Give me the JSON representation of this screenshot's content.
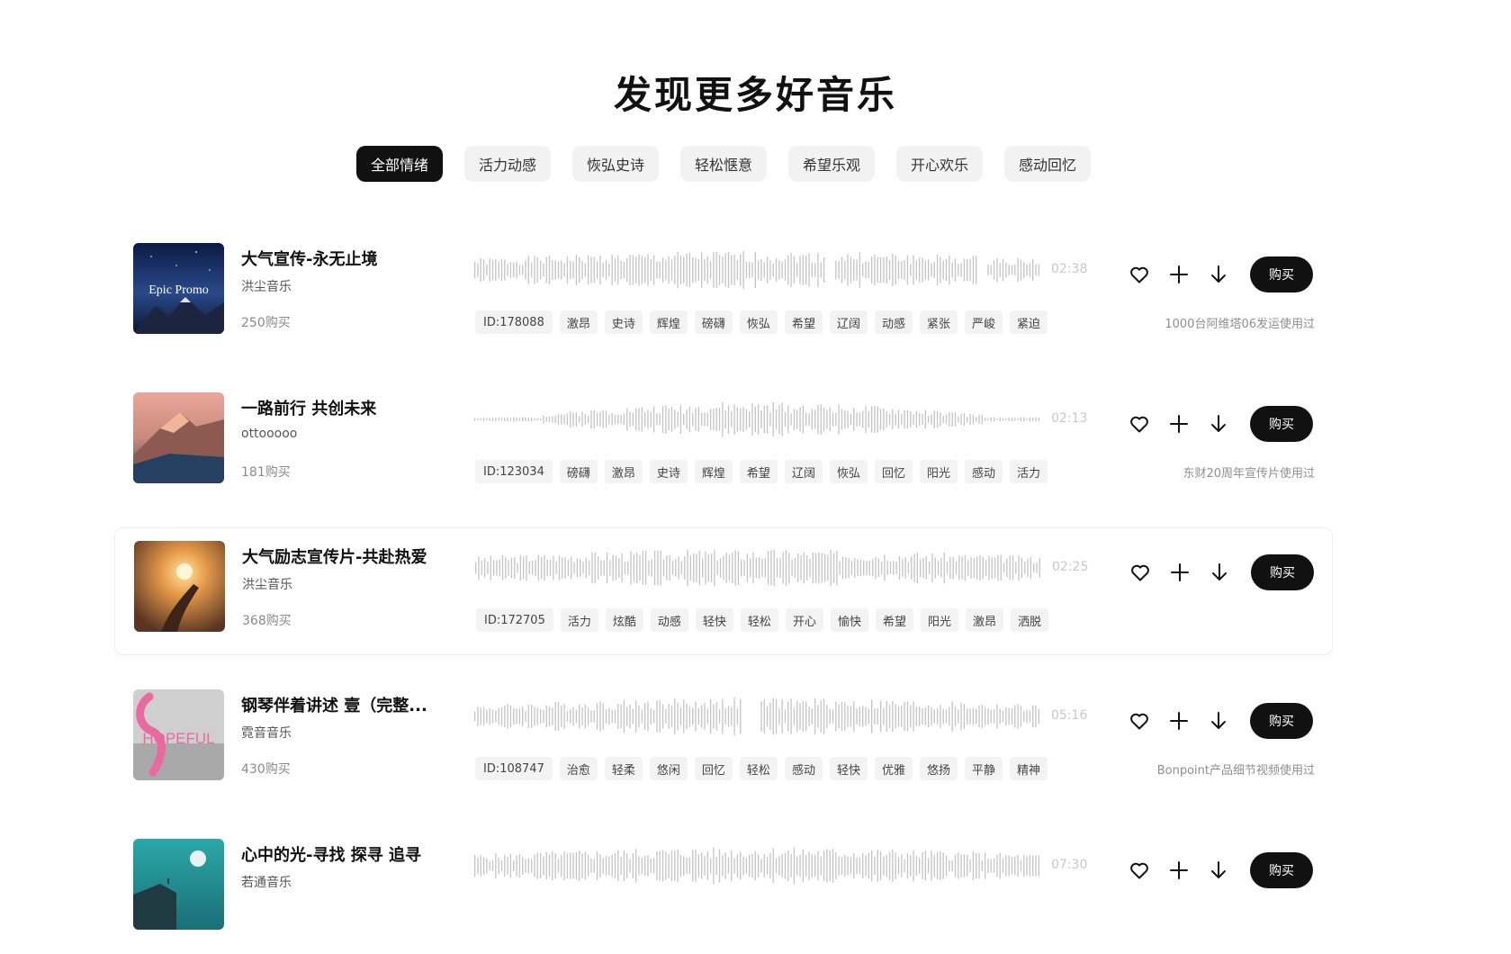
{
  "page": {
    "title": "发现更多好音乐"
  },
  "filters": [
    {
      "label": "全部情绪",
      "active": true
    },
    {
      "label": "活力动感",
      "active": false
    },
    {
      "label": "恢弘史诗",
      "active": false
    },
    {
      "label": "轻松惬意",
      "active": false
    },
    {
      "label": "希望乐观",
      "active": false
    },
    {
      "label": "开心欢乐",
      "active": false
    },
    {
      "label": "感动回忆",
      "active": false
    }
  ],
  "tracks": [
    {
      "title": "大气宣传-永无止境",
      "author": "洪尘音乐",
      "sales": "250购买",
      "duration": "02:38",
      "id_label": "ID:178088",
      "tags": [
        "激昂",
        "史诗",
        "辉煌",
        "磅礴",
        "恢弘",
        "希望",
        "辽阔",
        "动感",
        "紧张",
        "严峻",
        "紧迫"
      ],
      "usage": "1000台阿维塔06发运使用过",
      "buy_label": "购买",
      "cover_text": "Epic Promo"
    },
    {
      "title": "一路前行 共创未来",
      "author": "ottooooo",
      "sales": "181购买",
      "duration": "02:13",
      "id_label": "ID:123034",
      "tags": [
        "磅礴",
        "激昂",
        "史诗",
        "辉煌",
        "希望",
        "辽阔",
        "恢弘",
        "回忆",
        "阳光",
        "感动",
        "活力"
      ],
      "usage": "东财20周年宣传片使用过",
      "buy_label": "购买",
      "cover_text": ""
    },
    {
      "title": "大气励志宣传片-共赴热爱",
      "author": "洪尘音乐",
      "sales": "368购买",
      "duration": "02:25",
      "id_label": "ID:172705",
      "tags": [
        "活力",
        "炫酷",
        "动感",
        "轻快",
        "轻松",
        "开心",
        "愉快",
        "希望",
        "阳光",
        "激昂",
        "洒脱"
      ],
      "usage": "",
      "buy_label": "购买",
      "cover_text": ""
    },
    {
      "title": "钢琴伴着讲述 壹（完整...",
      "author": "霓音音乐",
      "sales": "430购买",
      "duration": "05:16",
      "id_label": "ID:108747",
      "tags": [
        "治愈",
        "轻柔",
        "悠闲",
        "回忆",
        "轻松",
        "感动",
        "轻快",
        "优雅",
        "悠扬",
        "平静",
        "精神"
      ],
      "usage": "Bonpoint产品细节视频使用过",
      "buy_label": "购买",
      "cover_text": "HOPEFUL"
    },
    {
      "title": "心中的光-寻找 探寻 追寻",
      "author": "若通音乐",
      "sales": "",
      "duration": "07:30",
      "id_label": "",
      "tags": [],
      "usage": "",
      "buy_label": "购买",
      "cover_text": ""
    }
  ],
  "colors": {
    "accent": "#111111",
    "chip_bg": "#f2f2f2",
    "tag_bg": "#f3f3f3",
    "wave": "#c4c4c4"
  },
  "icons": [
    "heart-icon",
    "plus-icon",
    "download-icon"
  ]
}
